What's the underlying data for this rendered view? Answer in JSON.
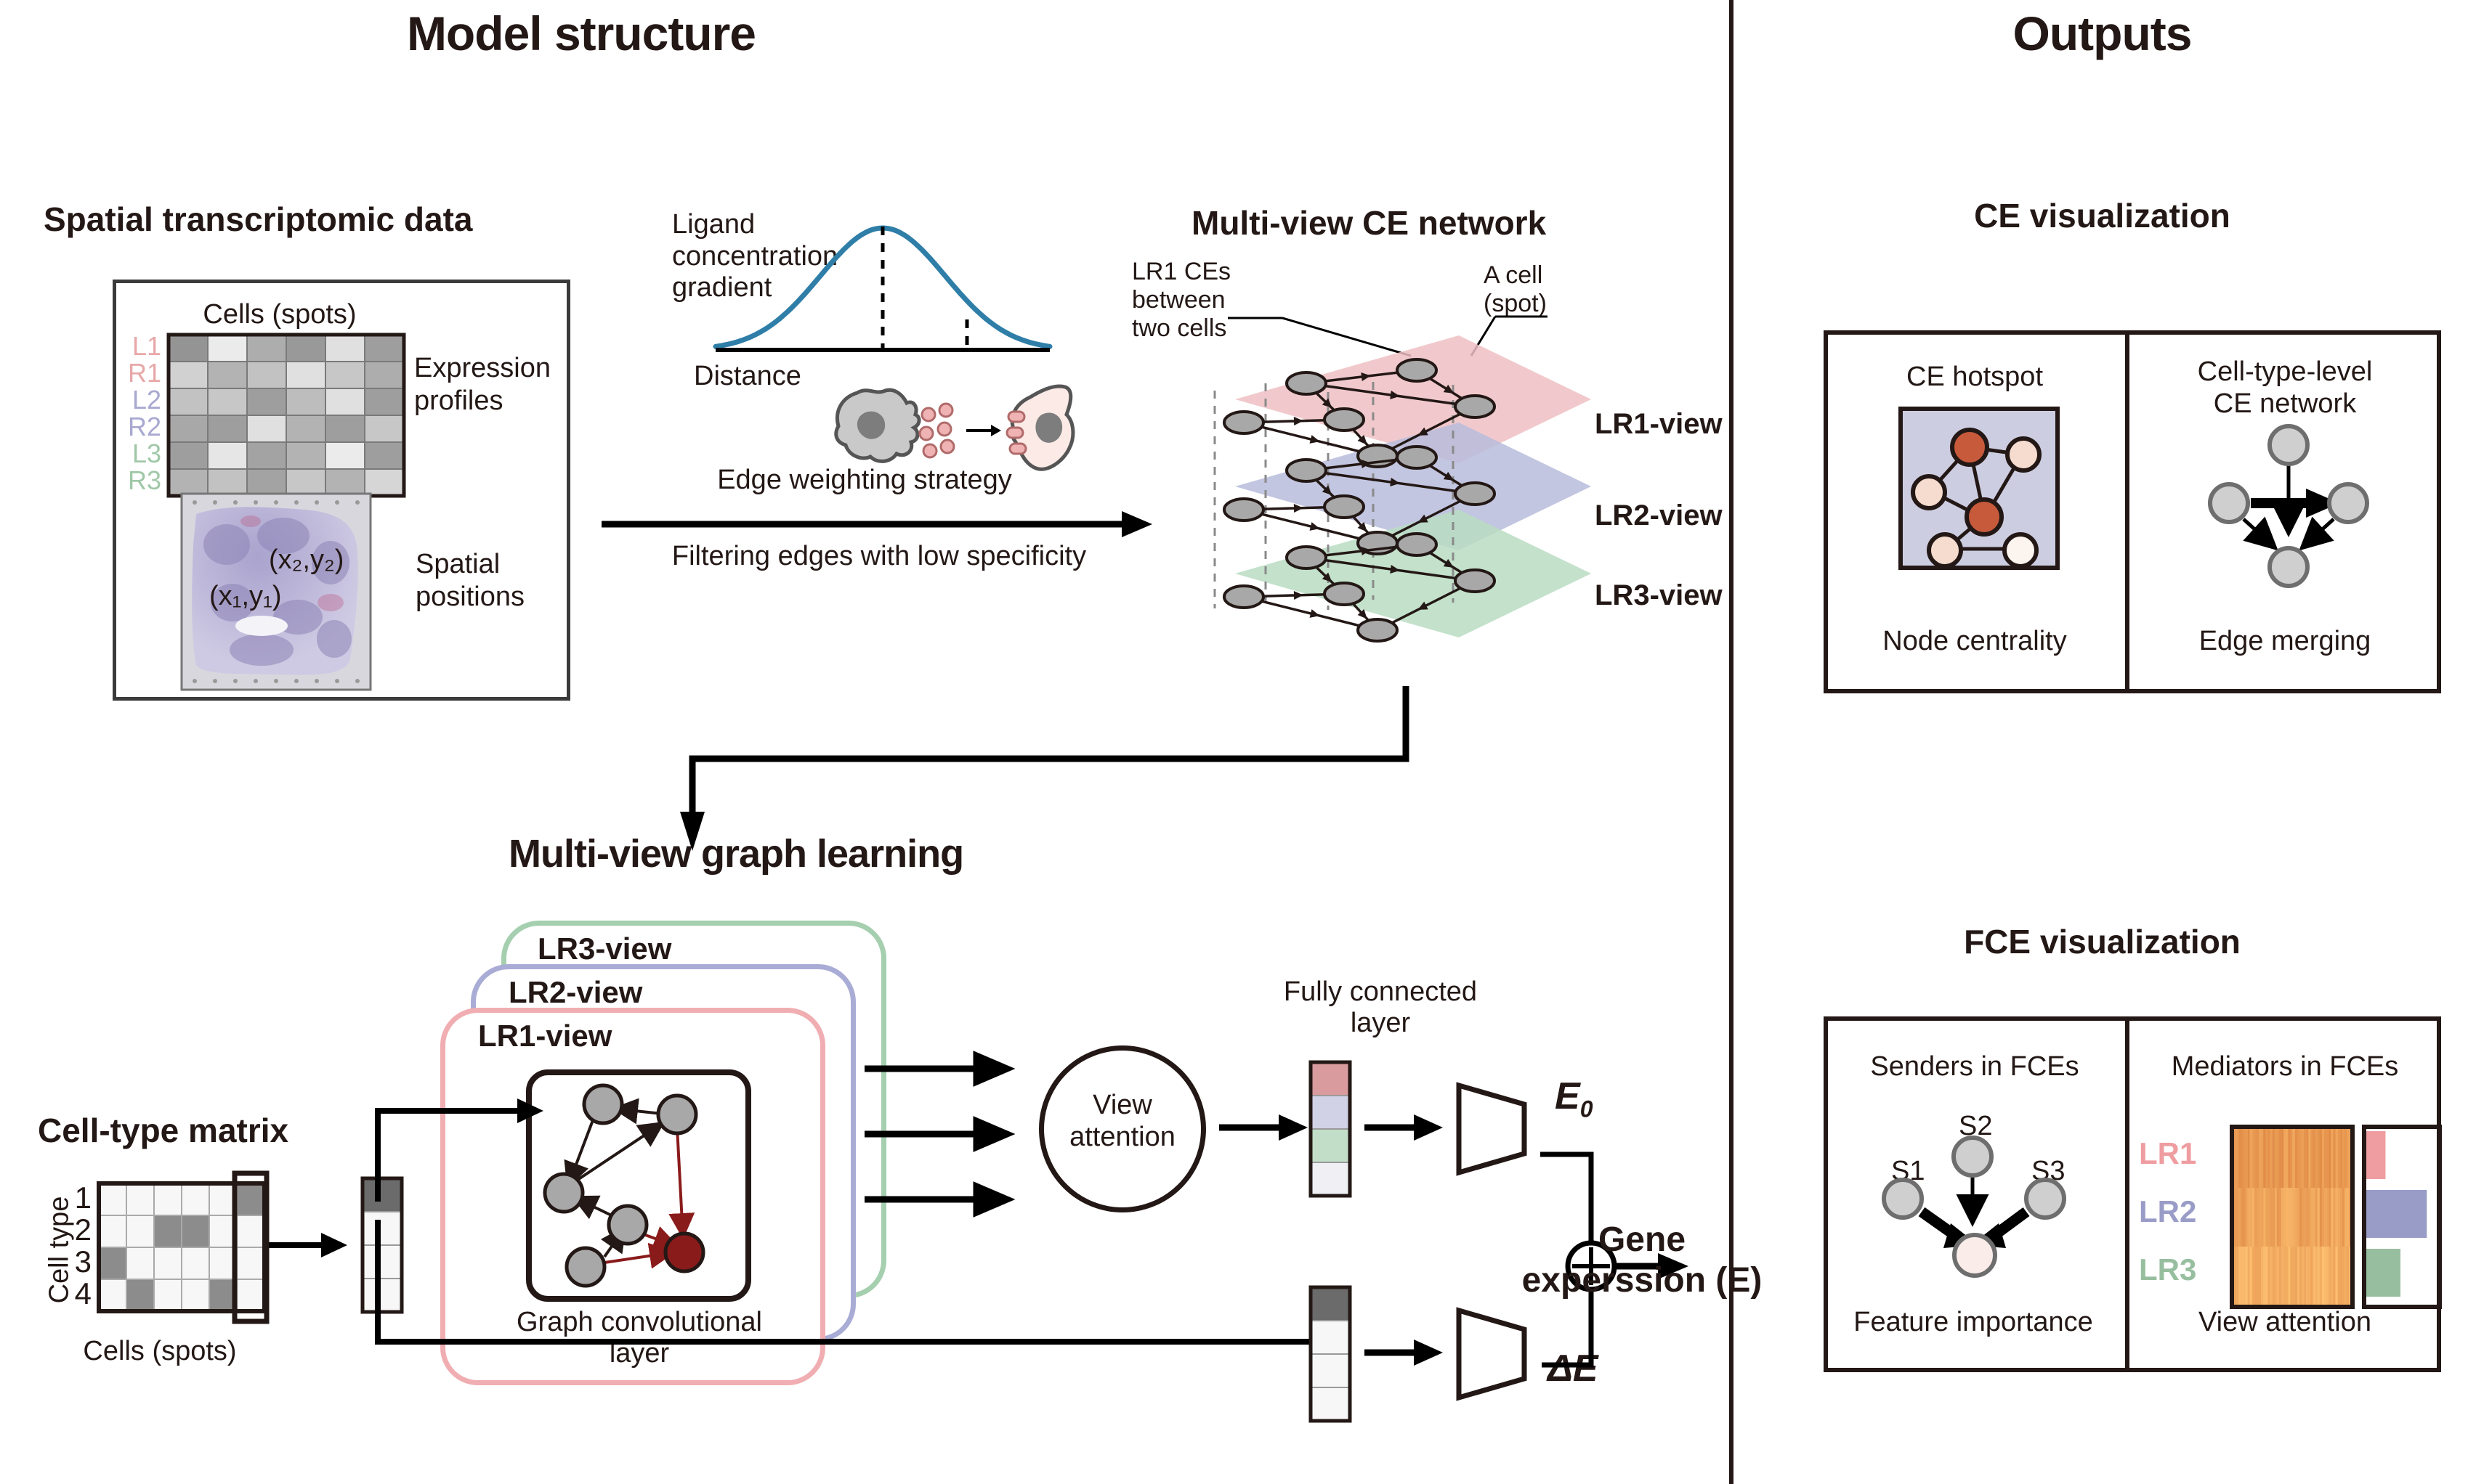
{
  "headings": {
    "model_structure": "Model structure",
    "outputs": "Outputs",
    "spatial_data": "Spatial transcriptomic data",
    "multiview_ce": "Multi-view CE network",
    "multiview_graph": "Multi-view graph learning",
    "ce_visualization": "CE visualization",
    "fce_visualization": "FCE visualization",
    "cell_type_matrix": "Cell-type matrix"
  },
  "spatial_panel": {
    "cells_spots_top": "Cells (spots)",
    "expression_profiles": "Expression\nprofiles",
    "spatial_positions": "Spatial\npositions",
    "row_labels": [
      "L1",
      "R1",
      "L2",
      "R2",
      "L3",
      "R3"
    ],
    "coord1": "(x₁,y₁)",
    "coord2": "(x₂,y₂)",
    "expression_matrix": [
      [
        0.58,
        0.92,
        0.68,
        0.6,
        0.88,
        0.62
      ],
      [
        0.82,
        0.7,
        0.76,
        0.88,
        0.78,
        0.68
      ],
      [
        0.76,
        0.78,
        0.62,
        0.74,
        0.88,
        0.62
      ],
      [
        0.66,
        0.62,
        0.88,
        0.7,
        0.62,
        0.78
      ],
      [
        0.62,
        0.9,
        0.64,
        0.7,
        0.92,
        0.62
      ],
      [
        0.7,
        0.76,
        0.64,
        0.78,
        0.7,
        0.84
      ]
    ]
  },
  "gradient_panel": {
    "ligand_label": "Ligand\nconcentration\ngradient",
    "distance_label": "Distance",
    "edge_weighting": "Edge weighting strategy",
    "filtering": "Filtering edges with low specificity",
    "curve_color": "#2E7EA8"
  },
  "ce_network": {
    "lr1_note": "LR1 CEs\nbetween\ntwo cells",
    "cell_note": "A cell\n(spot)",
    "layers": [
      {
        "name": "LR1-view",
        "color": "#EFC0C3"
      },
      {
        "name": "LR2-view",
        "color": "#B9BCDC"
      },
      {
        "name": "LR3-view",
        "color": "#B9DCC2"
      }
    ]
  },
  "graph_learning": {
    "views": [
      {
        "name": "LR1-view",
        "color": "#F0AEB2"
      },
      {
        "name": "LR2-view",
        "color": "#A9ACD5"
      },
      {
        "name": "LR3-view",
        "color": "#A5CFAF"
      }
    ],
    "gcn_label": "Graph convolutional\nlayer",
    "view_attention": "View\nattention",
    "fully_connected": "Fully connected\nlayer",
    "e0_label": "E",
    "e0_sub": "0",
    "delta_e": "ΔE",
    "gene_expression": "Gene\nexperssion (E)",
    "fc_vector_colors": [
      "#D99B9E",
      "#D2D2E6",
      "#C2DEC8",
      "#EFEFF4"
    ],
    "ct_vector_shades": [
      0.42,
      0.97,
      0.97,
      0.97
    ]
  },
  "cell_type_panel": {
    "axis_y": "Cell type",
    "axis_x": "Cells (spots)",
    "row_labels": [
      "1",
      "2",
      "3",
      "4"
    ],
    "matrix": [
      [
        0.97,
        0.97,
        0.97,
        0.97,
        0.97,
        0.55
      ],
      [
        0.97,
        0.97,
        0.55,
        0.55,
        0.97,
        0.97
      ],
      [
        0.55,
        0.97,
        0.97,
        0.97,
        0.97,
        0.97
      ],
      [
        0.97,
        0.55,
        0.97,
        0.97,
        0.55,
        0.97
      ]
    ]
  },
  "ce_vis": {
    "left_title": "CE hotspot",
    "left_caption": "Node centrality",
    "right_title": "Cell-type-level\nCE network",
    "right_caption": "Edge merging",
    "hotspot_bg": "#CDCDE2",
    "node_colors": [
      "#C85A3C",
      "#F5DCCE",
      "#F5DCCE",
      "#C85A3C",
      "#F5DCCE",
      "#FCF4EF"
    ]
  },
  "fce_vis": {
    "left_title": "Senders in FCEs",
    "left_caption": "Feature importance",
    "right_title": "Mediators in FCEs",
    "right_caption": "View attention",
    "sender_labels": [
      "S1",
      "S2",
      "S3"
    ],
    "lr_labels": [
      {
        "name": "LR1",
        "color": "#EF9DA0",
        "attention": 0.27
      },
      {
        "name": "LR2",
        "color": "#9A9CC8",
        "attention": 0.85
      },
      {
        "name": "LR3",
        "color": "#97BF9F",
        "attention": 0.48
      }
    ],
    "receiver_color": "#FAEDE9"
  }
}
